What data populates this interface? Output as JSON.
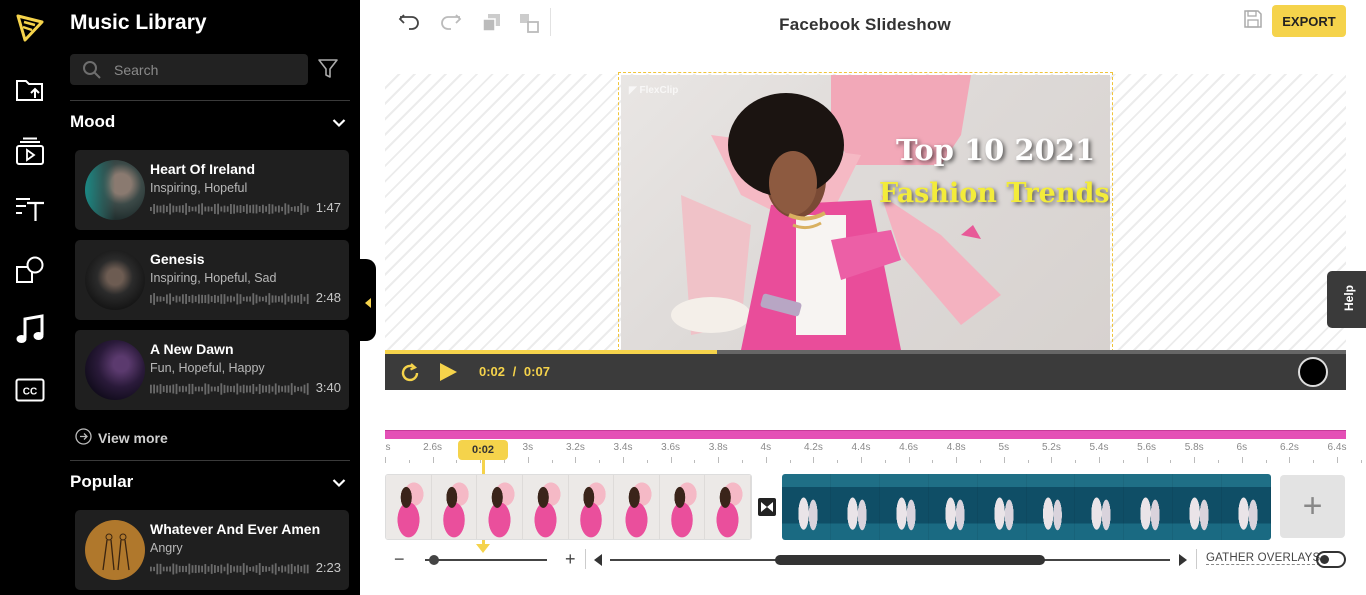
{
  "app": {
    "document_title": "Facebook Slideshow",
    "export_label": "EXPORT",
    "help_label": "Help"
  },
  "rail": {
    "items": [
      {
        "icon": "logo-icon"
      },
      {
        "icon": "upload-folder-icon"
      },
      {
        "icon": "media-library-icon"
      },
      {
        "icon": "text-icon"
      },
      {
        "icon": "elements-icon"
      },
      {
        "icon": "music-icon",
        "active": true
      },
      {
        "icon": "captions-icon"
      }
    ]
  },
  "music": {
    "title": "Music Library",
    "search_placeholder": "Search",
    "sections": [
      {
        "title": "Mood",
        "tracks": [
          {
            "title": "Heart Of Ireland",
            "tags": "Inspiring, Hopeful",
            "duration": "1:47"
          },
          {
            "title": "Genesis",
            "tags": "Inspiring, Hopeful, Sad",
            "duration": "2:48"
          },
          {
            "title": "A New Dawn",
            "tags": "Fun, Hopeful, Happy",
            "duration": "3:40"
          }
        ],
        "view_more": "View more"
      },
      {
        "title": "Popular",
        "tracks": [
          {
            "title": "Whatever And Ever Amen",
            "tags": "Angry",
            "duration": "2:23"
          }
        ]
      }
    ]
  },
  "preview": {
    "headline_line1": "Top 10 2021",
    "headline_line2": "Fashion Trends",
    "current_time": "0:02",
    "total_time": "0:07",
    "time_separator": "/",
    "progress": 0.345
  },
  "timeline": {
    "playhead_label": "0:02",
    "ruler_labels": [
      "s",
      "2.6s",
      "2.8s",
      "3s",
      "3.2s",
      "3.4s",
      "3.6s",
      "3.8s",
      "4s",
      "4.2s",
      "4.4s",
      "4.6s",
      "4.8s",
      "5s",
      "5.2s",
      "5.4s",
      "5.6s",
      "5.8s",
      "6s",
      "6.2s",
      "6.4s"
    ],
    "gather_overlays_label": "GATHER OVERLAYS",
    "add_clip_label": "+",
    "zoom_minus": "−",
    "zoom_plus": "+"
  },
  "colors": {
    "accent": "#f5d34b",
    "overlay_track": "#e44fb6",
    "sidebar_bg": "#000000"
  }
}
